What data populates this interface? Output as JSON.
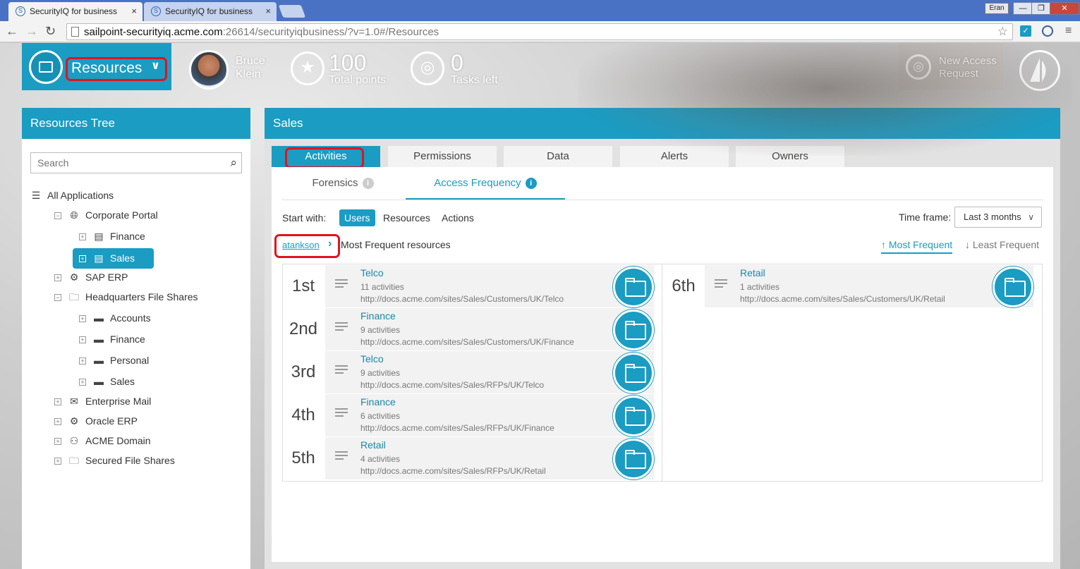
{
  "browser": {
    "tabs": [
      {
        "label": "SecurityIQ for business",
        "close": "×"
      },
      {
        "label": "SecurityIQ for business",
        "close": "×"
      }
    ],
    "user_badge": "Eran",
    "window_buttons": {
      "minimize": "—",
      "restore": "❐",
      "close": "✕"
    },
    "url_host": "sailpoint-securityiq.acme.com",
    "url_path": ":26614/securityiqbusiness/?v=1.0#/Resources"
  },
  "header": {
    "module_label": "Resources",
    "user_first": "Bruce",
    "user_last": "Klein",
    "points_value": "100",
    "points_label": "Total points",
    "tasks_value": "0",
    "tasks_label": "Tasks left",
    "new_access_line1": "New Access",
    "new_access_line2": "Request"
  },
  "tree": {
    "title": "Resources Tree",
    "search_placeholder": "Search",
    "items": [
      {
        "label": "All Applications"
      },
      {
        "label": "Corporate Portal",
        "exp": "−"
      },
      {
        "label": "Finance",
        "exp": "+"
      },
      {
        "label": "Sales",
        "exp": "+"
      },
      {
        "label": "SAP ERP",
        "exp": "+"
      },
      {
        "label": "Headquarters File Shares",
        "exp": "−"
      },
      {
        "label": "Accounts",
        "exp": "+"
      },
      {
        "label": "Finance",
        "exp": "+"
      },
      {
        "label": "Personal",
        "exp": "+"
      },
      {
        "label": "Sales",
        "exp": "+"
      },
      {
        "label": "Enterprise Mail",
        "exp": "+"
      },
      {
        "label": "Oracle ERP",
        "exp": "+"
      },
      {
        "label": "ACME Domain",
        "exp": "+"
      },
      {
        "label": "Secured File Shares",
        "exp": "+"
      }
    ]
  },
  "main": {
    "title": "Sales",
    "tabs": [
      "Activities",
      "Permissions",
      "Data",
      "Alerts",
      "Owners"
    ],
    "subtabs": [
      "Forensics",
      "Access Frequency"
    ],
    "start_with_label": "Start with:",
    "start_with_options": [
      "Users",
      "Resources",
      "Actions"
    ],
    "timeframe_label": "Time frame:",
    "timeframe_value": "Last 3 months",
    "crumb_user": "atankson",
    "crumb_text": "Most Frequent resources",
    "sort_most": "Most Frequent",
    "sort_least": "Least Frequent",
    "results": [
      {
        "rank": "1st",
        "name": "Telco",
        "activities": "11 activities",
        "url": "http://docs.acme.com/sites/Sales/Customers/UK/Telco"
      },
      {
        "rank": "2nd",
        "name": "Finance",
        "activities": "9 activities",
        "url": "http://docs.acme.com/sites/Sales/Customers/UK/Finance"
      },
      {
        "rank": "3rd",
        "name": "Telco",
        "activities": "9 activities",
        "url": "http://docs.acme.com/sites/Sales/RFPs/UK/Telco"
      },
      {
        "rank": "4th",
        "name": "Finance",
        "activities": "6 activities",
        "url": "http://docs.acme.com/sites/Sales/RFPs/UK/Finance"
      },
      {
        "rank": "5th",
        "name": "Retail",
        "activities": "4 activities",
        "url": "http://docs.acme.com/sites/Sales/RFPs/UK/Retail"
      },
      {
        "rank": "6th",
        "name": "Retail",
        "activities": "1 activities",
        "url": "http://docs.acme.com/sites/Sales/Customers/UK/Retail"
      }
    ]
  },
  "colors": {
    "accent": "#1a9cc3",
    "highlight_ring": "#e0141e",
    "titlebar": "#4a72c4"
  }
}
